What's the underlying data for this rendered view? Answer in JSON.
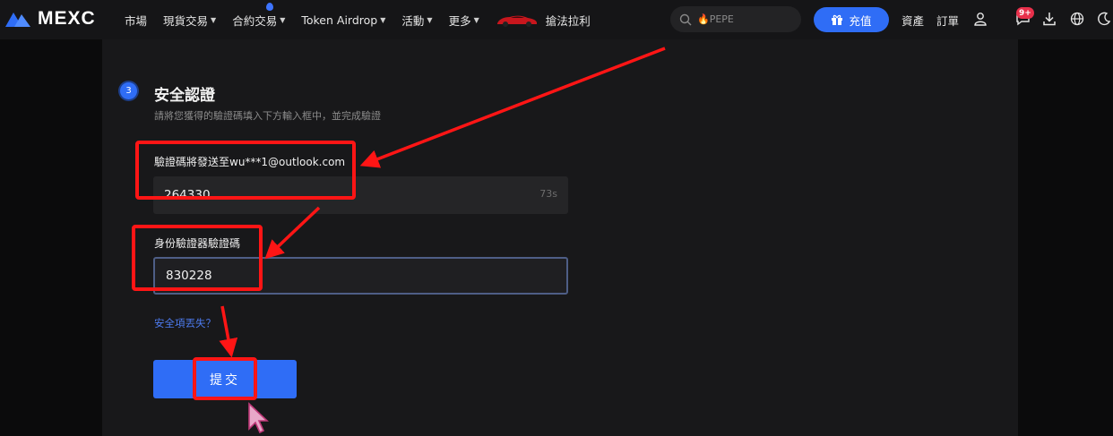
{
  "nav": {
    "brand": "MEXC",
    "items": [
      {
        "label": "市場",
        "caret": false
      },
      {
        "label": "現貨交易",
        "caret": true
      },
      {
        "label": "合約交易",
        "caret": true
      },
      {
        "label": "Token Airdrop",
        "caret": true
      },
      {
        "label": "活動",
        "caret": true
      },
      {
        "label": "更多",
        "caret": true
      }
    ],
    "promo_label": "搶法拉利",
    "search_placeholder": "🔥PEPE",
    "deposit_label": "充值",
    "assets_label": "資產",
    "orders_label": "訂單",
    "notification_badge": "9+"
  },
  "step": {
    "number": "3",
    "title": "安全認證",
    "description": "請將您獲得的驗證碼填入下方輸入框中，並完成驗證"
  },
  "email_code": {
    "label": "驗證碼將發送至wu***1@outlook.com",
    "value": "264330",
    "countdown": "73s"
  },
  "authenticator": {
    "label": "身份驗證器驗證碼",
    "value": "830228"
  },
  "lost_link": "安全項丟失？",
  "submit_label": "提交",
  "colors": {
    "accent": "#2f6df6",
    "highlight": "#ff1515",
    "background": "#18181a"
  }
}
